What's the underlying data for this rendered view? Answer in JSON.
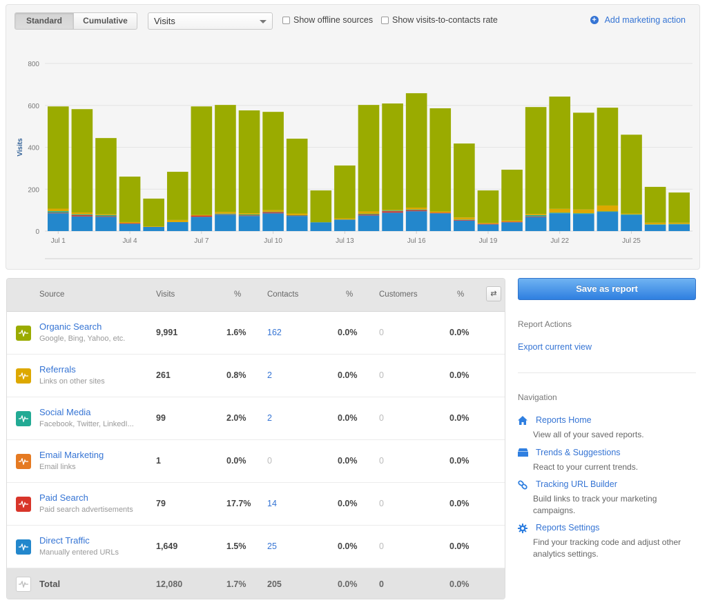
{
  "toolbar": {
    "mode_standard": "Standard",
    "mode_cumulative": "Cumulative",
    "metric_select": "Visits",
    "show_offline_sources": "Show offline sources",
    "show_rate": "Show visits-to-contacts rate",
    "add_marketing_action": "Add marketing action"
  },
  "colors": {
    "organic": "#9aab00",
    "referrals": "#dda800",
    "social": "#22aa94",
    "email": "#e57a22",
    "paid": "#d8352a",
    "direct": "#2387cc",
    "link": "#3574d4"
  },
  "chart_data": {
    "type": "bar",
    "stacked": true,
    "title": "",
    "xlabel": "",
    "ylabel": "Visits",
    "ylim": [
      0,
      800
    ],
    "yticks": [
      0,
      200,
      400,
      600,
      800
    ],
    "grid": true,
    "legend": "none",
    "categories": [
      "Jul 1",
      "Jul 2",
      "Jul 3",
      "Jul 4",
      "Jul 5",
      "Jul 6",
      "Jul 7",
      "Jul 8",
      "Jul 9",
      "Jul 10",
      "Jul 11",
      "Jul 12",
      "Jul 13",
      "Jul 14",
      "Jul 15",
      "Jul 16",
      "Jul 17",
      "Jul 18",
      "Jul 19",
      "Jul 20",
      "Jul 21",
      "Jul 22",
      "Jul 23",
      "Jul 24",
      "Jul 25",
      "Jul 26",
      "Jul 27"
    ],
    "xtick_labels": [
      "Jul 1",
      "",
      "",
      "Jul 4",
      "",
      "",
      "Jul 7",
      "",
      "",
      "Jul 10",
      "",
      "",
      "Jul 13",
      "",
      "",
      "Jul 16",
      "",
      "",
      "Jul 19",
      "",
      "",
      "Jul 22",
      "",
      "",
      "Jul 25",
      "",
      ""
    ],
    "series": [
      {
        "name": "Direct Traffic",
        "color": "#2387cc",
        "values": [
          85,
          70,
          68,
          35,
          20,
          43,
          68,
          78,
          72,
          85,
          72,
          42,
          55,
          75,
          88,
          95,
          85,
          50,
          32,
          42,
          67,
          85,
          82,
          92,
          77,
          30,
          32
        ]
      },
      {
        "name": "Paid Search",
        "color": "#d8352a",
        "values": [
          3,
          6,
          3,
          3,
          0,
          0,
          6,
          2,
          3,
          5,
          2,
          0,
          0,
          4,
          7,
          5,
          3,
          3,
          3,
          3,
          3,
          0,
          0,
          0,
          0,
          0,
          0
        ]
      },
      {
        "name": "Email Marketing",
        "color": "#e57a22",
        "values": [
          0,
          0,
          0,
          0,
          0,
          0,
          0,
          0,
          0,
          0,
          0,
          0,
          0,
          0,
          0,
          0,
          0,
          0,
          0,
          0,
          0,
          0,
          0,
          0,
          0,
          0,
          0
        ]
      },
      {
        "name": "Social Media",
        "color": "#22aa94",
        "values": [
          7,
          4,
          5,
          0,
          0,
          0,
          0,
          3,
          4,
          2,
          2,
          0,
          0,
          3,
          3,
          3,
          0,
          2,
          0,
          0,
          6,
          3,
          3,
          2,
          3,
          2,
          2
        ]
      },
      {
        "name": "Referrals",
        "color": "#dda800",
        "values": [
          12,
          9,
          4,
          5,
          3,
          10,
          3,
          8,
          6,
          8,
          8,
          0,
          6,
          12,
          3,
          9,
          6,
          10,
          4,
          5,
          6,
          18,
          18,
          28,
          4,
          8,
          6
        ]
      },
      {
        "name": "Organic Search",
        "color": "#9aab00",
        "values": [
          488,
          493,
          364,
          217,
          132,
          230,
          518,
          511,
          491,
          469,
          357,
          152,
          252,
          508,
          508,
          546,
          492,
          353,
          155,
          243,
          510,
          536,
          462,
          467,
          376,
          171,
          144
        ]
      }
    ]
  },
  "table": {
    "headers": {
      "source": "Source",
      "visits": "Visits",
      "visits_pct": "%",
      "contacts": "Contacts",
      "contacts_pct": "%",
      "customers": "Customers",
      "customers_pct": "%"
    },
    "rows": [
      {
        "name": "Organic Search",
        "desc": "Google, Bing, Yahoo, etc.",
        "color": "#9aab00",
        "visits": "9,991",
        "visits_pct": "1.6%",
        "contacts": "162",
        "contacts_pct": "0.0%",
        "customers": "0",
        "customers_pct": "0.0%"
      },
      {
        "name": "Referrals",
        "desc": "Links on other sites",
        "color": "#dda800",
        "visits": "261",
        "visits_pct": "0.8%",
        "contacts": "2",
        "contacts_pct": "0.0%",
        "customers": "0",
        "customers_pct": "0.0%"
      },
      {
        "name": "Social Media",
        "desc": "Facebook, Twitter, LinkedI...",
        "color": "#22aa94",
        "visits": "99",
        "visits_pct": "2.0%",
        "contacts": "2",
        "contacts_pct": "0.0%",
        "customers": "0",
        "customers_pct": "0.0%"
      },
      {
        "name": "Email Marketing",
        "desc": "Email links",
        "color": "#e57a22",
        "visits": "1",
        "visits_pct": "0.0%",
        "contacts": "0",
        "contacts_pct": "0.0%",
        "customers": "0",
        "customers_pct": "0.0%"
      },
      {
        "name": "Paid Search",
        "desc": "Paid search advertisements",
        "color": "#d8352a",
        "visits": "79",
        "visits_pct": "17.7%",
        "contacts": "14",
        "contacts_pct": "0.0%",
        "customers": "0",
        "customers_pct": "0.0%"
      },
      {
        "name": "Direct Traffic",
        "desc": "Manually entered URLs",
        "color": "#2387cc",
        "visits": "1,649",
        "visits_pct": "1.5%",
        "contacts": "25",
        "contacts_pct": "0.0%",
        "customers": "0",
        "customers_pct": "0.0%"
      }
    ],
    "total": {
      "label": "Total",
      "visits": "12,080",
      "visits_pct": "1.7%",
      "contacts": "205",
      "contacts_pct": "0.0%",
      "customers": "0",
      "customers_pct": "0.0%"
    }
  },
  "sidebar": {
    "save_button": "Save as report",
    "report_actions_heading": "Report Actions",
    "export_link": "Export current view",
    "navigation_heading": "Navigation",
    "nav": [
      {
        "icon": "home-icon",
        "title": "Reports Home",
        "desc": "View all of your saved reports."
      },
      {
        "icon": "inbox-icon",
        "title": "Trends & Suggestions",
        "desc": "React to your current trends."
      },
      {
        "icon": "link-icon",
        "title": "Tracking URL Builder",
        "desc": "Build links to track your marketing campaigns."
      },
      {
        "icon": "gear-icon",
        "title": "Reports Settings",
        "desc": "Find your tracking code and adjust other analytics settings."
      }
    ]
  }
}
